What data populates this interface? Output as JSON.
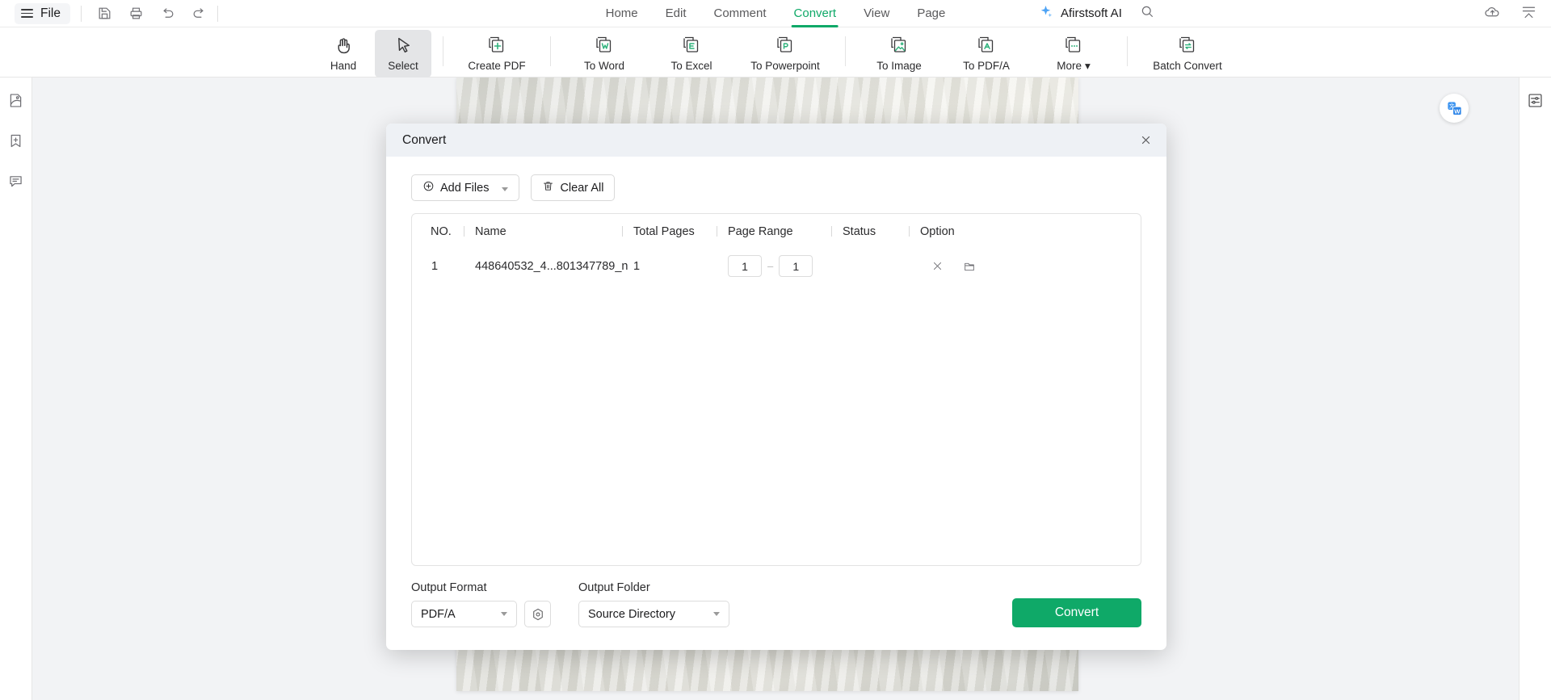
{
  "app": {
    "file_menu": "File",
    "ai_label": "Afirstsoft AI"
  },
  "quick_access": [
    {
      "name": "save-icon",
      "label": "Save"
    },
    {
      "name": "print-icon",
      "label": "Print"
    },
    {
      "name": "undo-icon",
      "label": "Undo"
    },
    {
      "name": "redo-icon",
      "label": "Redo"
    }
  ],
  "nav_tabs": [
    {
      "label": "Home",
      "active": false
    },
    {
      "label": "Edit",
      "active": false
    },
    {
      "label": "Comment",
      "active": false
    },
    {
      "label": "Convert",
      "active": true
    },
    {
      "label": "View",
      "active": false
    },
    {
      "label": "Page",
      "active": false
    }
  ],
  "ribbon": {
    "items": [
      {
        "label": "Hand",
        "icon": "hand-icon",
        "active": false
      },
      {
        "label": "Select",
        "icon": "cursor-icon",
        "active": true
      },
      {
        "label": "Create PDF",
        "icon": "create-pdf-icon",
        "active": false
      },
      {
        "label": "To Word",
        "icon": "to-word-icon",
        "active": false
      },
      {
        "label": "To Excel",
        "icon": "to-excel-icon",
        "active": false
      },
      {
        "label": "To Powerpoint",
        "icon": "to-powerpoint-icon",
        "active": false
      },
      {
        "label": "To Image",
        "icon": "to-image-icon",
        "active": false
      },
      {
        "label": "To PDF/A",
        "icon": "to-pdfa-icon",
        "active": false
      },
      {
        "label": "More",
        "icon": "more-icon",
        "active": false,
        "caret": "▾"
      },
      {
        "label": "Batch Convert",
        "icon": "batch-convert-icon",
        "active": false
      }
    ]
  },
  "left_rail": [
    {
      "name": "thumbnails-icon"
    },
    {
      "name": "bookmark-add-icon"
    },
    {
      "name": "comment-icon"
    }
  ],
  "right_rail": [
    {
      "name": "settings-sliders-icon"
    }
  ],
  "floating": {
    "name": "translate-icon"
  },
  "top_right": [
    {
      "name": "cloud-upload-icon"
    },
    {
      "name": "collapse-ribbon-icon"
    }
  ],
  "dialog": {
    "title": "Convert",
    "close_label": "×",
    "toolbar": {
      "add_files": "Add Files",
      "add_files_caret": "▾",
      "clear_all": "Clear All"
    },
    "table": {
      "headers": [
        "NO.",
        "Name",
        "Total Pages",
        "Page Range",
        "Status",
        "Option"
      ],
      "rows": [
        {
          "no": "1",
          "name": "448640532_4...801347789_n",
          "total_pages": "1",
          "range_from": "1",
          "range_to": "1",
          "range_dash": "—",
          "status": "",
          "options": [
            "close-icon",
            "folder-icon"
          ]
        }
      ]
    },
    "output_format": {
      "label": "Output Format",
      "value": "PDF/A"
    },
    "output_folder": {
      "label": "Output Folder",
      "value": "Source Directory"
    },
    "settings_icon": "format-settings-icon",
    "convert_button": "Convert"
  },
  "colors": {
    "accent_green": "#0fa968",
    "dialog_header": "#eef1f5",
    "canvas": "#f2f3f5"
  }
}
